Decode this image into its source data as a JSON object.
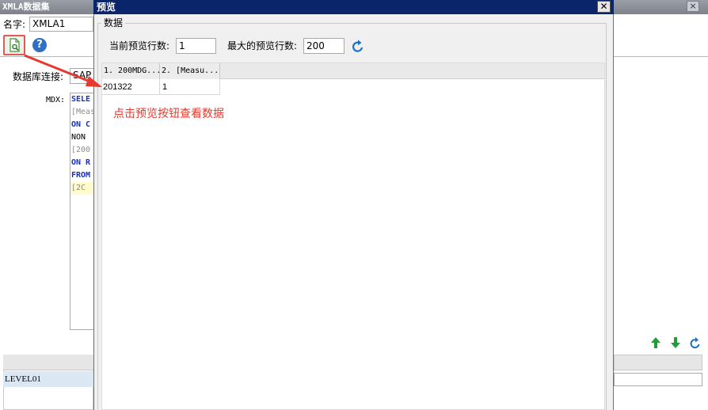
{
  "background_window": {
    "title": "XMLA数据集",
    "name_label": "名字:",
    "name_value": "XMLA1",
    "db_label": "数据库连接:",
    "db_value": "SAP",
    "mdx_label": "MDX:",
    "mdx_lines": [
      {
        "text": "SELE",
        "style": "kw"
      },
      {
        "text": "[Meas",
        "style": "gr"
      },
      {
        "text": "ON C",
        "style": "kw"
      },
      {
        "text": "NON",
        "style": "plain"
      },
      {
        "text": "[200",
        "style": "gr"
      },
      {
        "text": "ON R",
        "style": "kw"
      },
      {
        "text": "FROM",
        "style": "kw"
      },
      {
        "text": " [2C",
        "style": "hl"
      }
    ],
    "bottom_row_value": "LEVEL01",
    "icons": {
      "preview": "preview-icon",
      "help": "help-icon",
      "move_up": "arrow-up-icon",
      "move_down": "arrow-down-icon",
      "refresh": "refresh-icon"
    },
    "help_glyph": "?"
  },
  "dialog": {
    "title": "预览",
    "close_glyph": "✕",
    "group_label": "数据",
    "current_rows_label": "当前预览行数:",
    "current_rows_value": "1",
    "max_rows_label": "最大的预览行数:",
    "max_rows_value": "200",
    "grid": {
      "columns": [
        "1. 200MDG...",
        "2. [Measu..."
      ],
      "rows": [
        [
          "201322",
          "1"
        ]
      ]
    }
  },
  "annotation": {
    "text": "点击预览按钮查看数据",
    "color": "#e63a2e"
  },
  "colors": {
    "dialog_title_bar": "#0a2569",
    "annotation_red": "#e63a2e",
    "keyword_blue": "#1a2fc4",
    "icon_green": "#1e9e3a",
    "icon_blue": "#1e6fc8"
  }
}
